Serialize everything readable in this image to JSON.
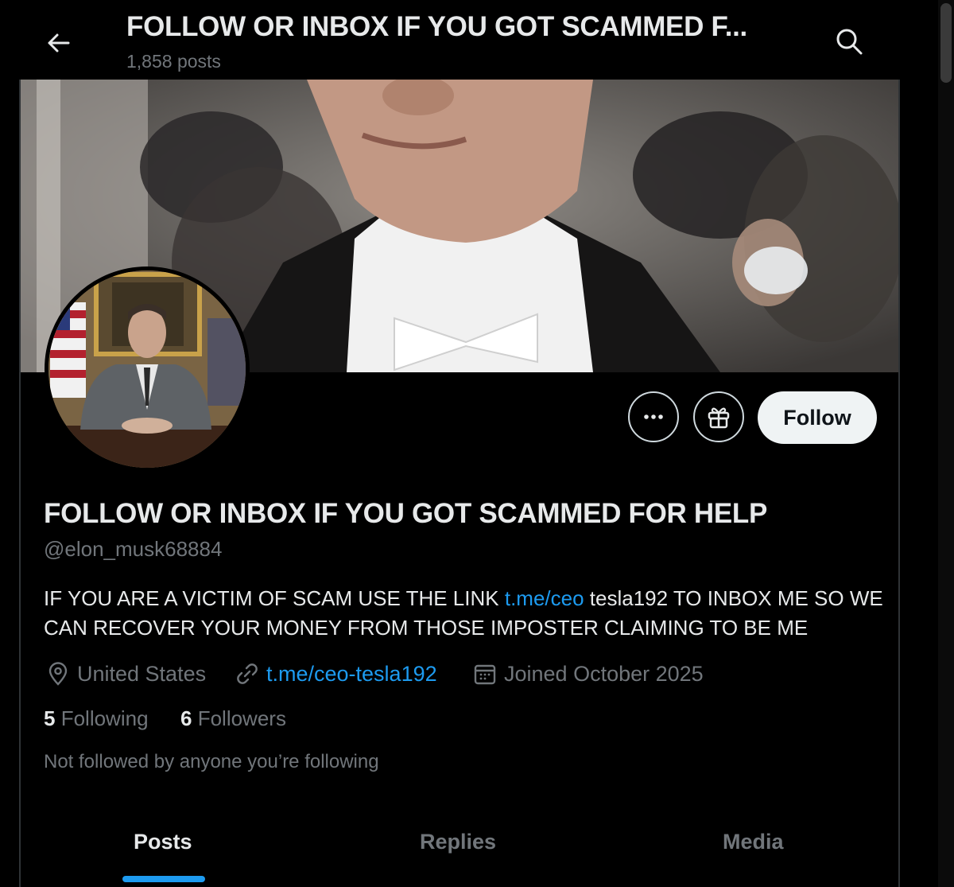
{
  "header": {
    "title": "FOLLOW OR INBOX IF YOU GOT SCAMMED F...",
    "post_count": "1,858 posts"
  },
  "icons": {
    "back": "arrow-left-icon",
    "search": "search-icon",
    "more": "more-horizontal-icon",
    "gift": "gift-icon",
    "location": "location-pin-icon",
    "link": "link-icon",
    "calendar": "calendar-icon"
  },
  "actions": {
    "follow_label": "Follow"
  },
  "profile": {
    "display_name": "FOLLOW OR INBOX IF YOU GOT SCAMMED FOR HELP",
    "handle": "@elon_musk68884",
    "bio_part1": "IF YOU ARE A VICTIM OF SCAM USE THE LINK ",
    "bio_link": "t.me/ceo",
    "bio_part2": " tesla192 TO INBOX ME SO WE CAN RECOVER YOUR MONEY FROM THOSE IMPOSTER CLAIMING TO BE ME",
    "location": "United States",
    "website": "t.me/ceo-tesla192",
    "joined": "Joined October 2025",
    "following_count": "5",
    "following_label": "Following",
    "followers_count": "6",
    "followers_label": "Followers",
    "not_followed": "Not followed by anyone you’re following"
  },
  "tabs": [
    {
      "label": "Posts",
      "active": true
    },
    {
      "label": "Replies",
      "active": false
    },
    {
      "label": "Media",
      "active": false
    }
  ],
  "colors": {
    "background": "#000000",
    "accent": "#1d9bf0",
    "primary_text": "#e7e9ea",
    "secondary_text": "#71767b",
    "follow_button_bg": "#eff3f4"
  }
}
